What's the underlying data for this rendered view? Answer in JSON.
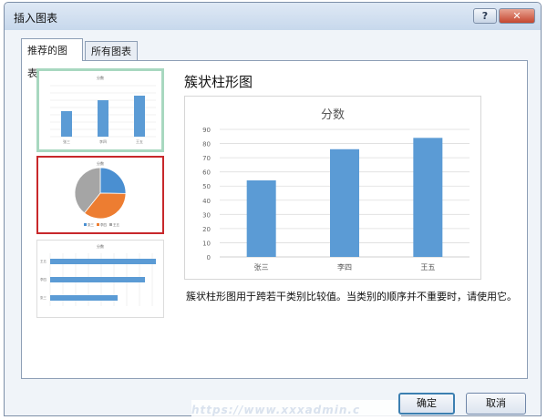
{
  "window": {
    "title": "插入图表",
    "help_label": "?",
    "close_label": "✕"
  },
  "tabs": [
    {
      "label": "推荐的图表",
      "active": true
    },
    {
      "label": "所有图表",
      "active": false
    }
  ],
  "thumbnails": [
    {
      "kind": "clustered-column",
      "title": "分数",
      "selected": true
    },
    {
      "kind": "pie",
      "title": "分数",
      "selected": false,
      "legend": [
        "张三",
        "李四",
        "王五"
      ]
    },
    {
      "kind": "clustered-bar",
      "title": "分数",
      "selected": false
    }
  ],
  "preview": {
    "title": "簇状柱形图",
    "description": "簇状柱形图用于跨若干类别比较值。当类别的顺序并不重要时，请使用它。"
  },
  "chart_data": {
    "type": "bar",
    "title": "分数",
    "categories": [
      "张三",
      "李四",
      "王五"
    ],
    "values": [
      54,
      76,
      84
    ],
    "ylim": [
      0,
      90
    ],
    "yticks": [
      0,
      10,
      20,
      30,
      40,
      50,
      60,
      70,
      80,
      90
    ],
    "grid": true,
    "bar_color": "#5b9bd5"
  },
  "pie_colors": [
    "#4a8fd1",
    "#ed7d31",
    "#a5a5a5"
  ],
  "buttons": {
    "ok": "确定",
    "cancel": "取消"
  },
  "watermark": "https://www.xxxadmin.c"
}
